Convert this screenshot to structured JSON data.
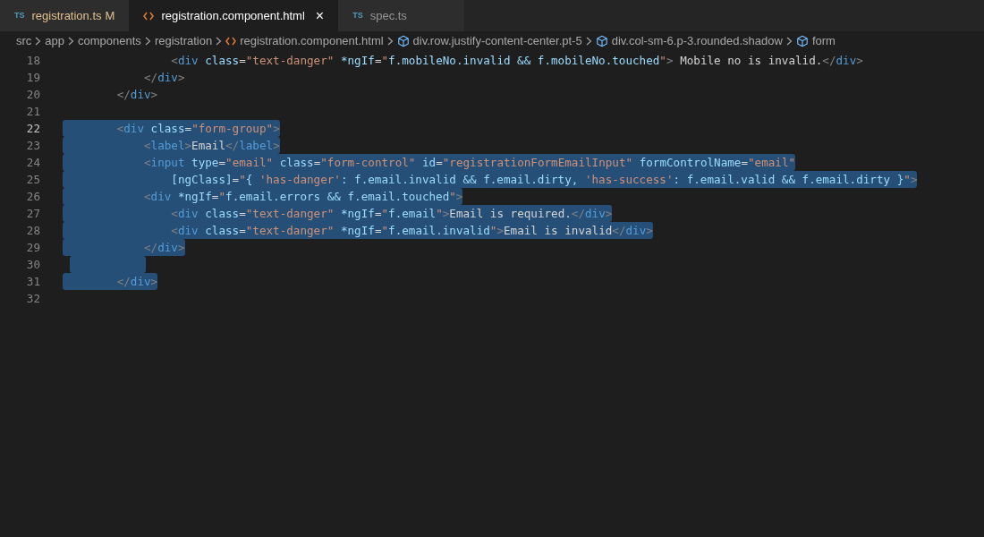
{
  "tabs": [
    {
      "badge": "TS",
      "label": "registration.ts",
      "modified": "M",
      "selected": false
    },
    {
      "label": "registration.component.html",
      "close": "×",
      "selected": true
    },
    {
      "badge": "TS",
      "label": "spec.ts",
      "selected": false
    }
  ],
  "breadcrumb": [
    {
      "kind": "folder",
      "label": "src"
    },
    {
      "kind": "folder",
      "label": "app"
    },
    {
      "kind": "folder",
      "label": "components"
    },
    {
      "kind": "folder",
      "label": "registration"
    },
    {
      "kind": "file",
      "label": "registration.component.html"
    },
    {
      "kind": "element",
      "label": "div.row.justify-content-center.pt-5"
    },
    {
      "kind": "element",
      "label": "div.col-sm-6.p-3.rounded.shadow"
    },
    {
      "kind": "element",
      "label": "form"
    }
  ],
  "lines": [
    {
      "number": "18",
      "active": false,
      "selected": false,
      "text": "                <div class=\"text-danger\" *ngIf=\"f.mobileNo.invalid && f.mobileNo.touched\"> Mobile no is invalid.</div>"
    },
    {
      "number": "19",
      "active": false,
      "selected": false,
      "text": "            </div>"
    },
    {
      "number": "20",
      "active": false,
      "selected": false,
      "text": "        </div>"
    },
    {
      "number": "21",
      "active": false,
      "selected": false
    },
    {
      "number": "22",
      "active": true,
      "selected": true,
      "text": "        <div class=\"form-group\">"
    },
    {
      "number": "23",
      "active": false,
      "selected": true,
      "text": "            <label>Email</label>"
    },
    {
      "number": "24",
      "active": false,
      "selected": true,
      "text": "            <input type=\"email\" class=\"form-control\" id=\"registrationFormEmailInput\" formControlName=\"email\""
    },
    {
      "number": "25",
      "active": false,
      "selected": true,
      "text": "                [ngClass]=\"{ 'has-danger': f.email.invalid && f.email.dirty, 'has-success': f.email.valid && f.email.dirty }\">"
    },
    {
      "number": "26",
      "active": false,
      "selected": true,
      "text": "            <div *ngIf=\"f.email.errors && f.email.touched\">"
    },
    {
      "number": "27",
      "active": false,
      "selected": true,
      "text": "                <div class=\"text-danger\" *ngIf=\"f.email\">Email is required.</div>"
    },
    {
      "number": "28",
      "active": false,
      "selected": true,
      "text": "                <div class=\"text-danger\" *ngIf=\"f.email.invalid\">Email is invalid</div>"
    },
    {
      "number": "29",
      "active": false,
      "selected": true,
      "text": "            </div>"
    },
    {
      "number": "30",
      "active": false,
      "selected": true
    },
    {
      "number": "31",
      "active": false,
      "selected": true,
      "text": "        </div>"
    },
    {
      "number": "32",
      "active": false,
      "selected": false
    }
  ]
}
